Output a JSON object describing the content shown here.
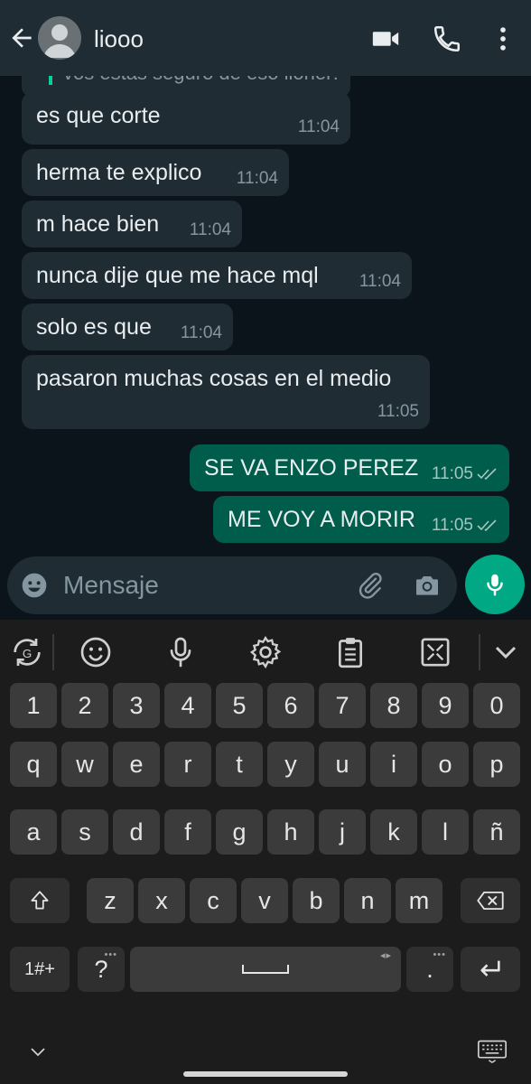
{
  "header": {
    "contact_name": "liooo"
  },
  "chat": {
    "quoted_text": "vos estas seguro de eso lionel?",
    "messages": [
      {
        "dir": "in",
        "text": "es que corte",
        "time": "11:04"
      },
      {
        "dir": "in",
        "text": "herma te explico",
        "time": "11:04"
      },
      {
        "dir": "in",
        "text": "m hace bien",
        "time": "11:04"
      },
      {
        "dir": "in",
        "text": "nunca dije que me hace mql",
        "time": "11:04"
      },
      {
        "dir": "in",
        "text": "solo es que",
        "time": "11:04"
      },
      {
        "dir": "in",
        "text": "pasaron muchas cosas en el medio",
        "time": "11:05"
      },
      {
        "dir": "out",
        "text": "SE VA ENZO PEREZ",
        "time": "11:05"
      },
      {
        "dir": "out",
        "text": "ME VOY A MORIR",
        "time": "11:05"
      }
    ]
  },
  "composer": {
    "placeholder": "Mensaje"
  },
  "keyboard": {
    "row_numbers": [
      "1",
      "2",
      "3",
      "4",
      "5",
      "6",
      "7",
      "8",
      "9",
      "0"
    ],
    "row_top": [
      "q",
      "w",
      "e",
      "r",
      "t",
      "y",
      "u",
      "i",
      "o",
      "p"
    ],
    "row_home": [
      "a",
      "s",
      "d",
      "f",
      "g",
      "h",
      "j",
      "k",
      "l",
      "ñ"
    ],
    "row_bottom": [
      "z",
      "x",
      "c",
      "v",
      "b",
      "n",
      "m"
    ],
    "symbols_label": "1#+",
    "question_label": "?",
    "period_label": "."
  },
  "colors": {
    "incoming": "#1f2c34",
    "outgoing": "#005c4b",
    "accent": "#00a884",
    "background": "#0b141a"
  }
}
